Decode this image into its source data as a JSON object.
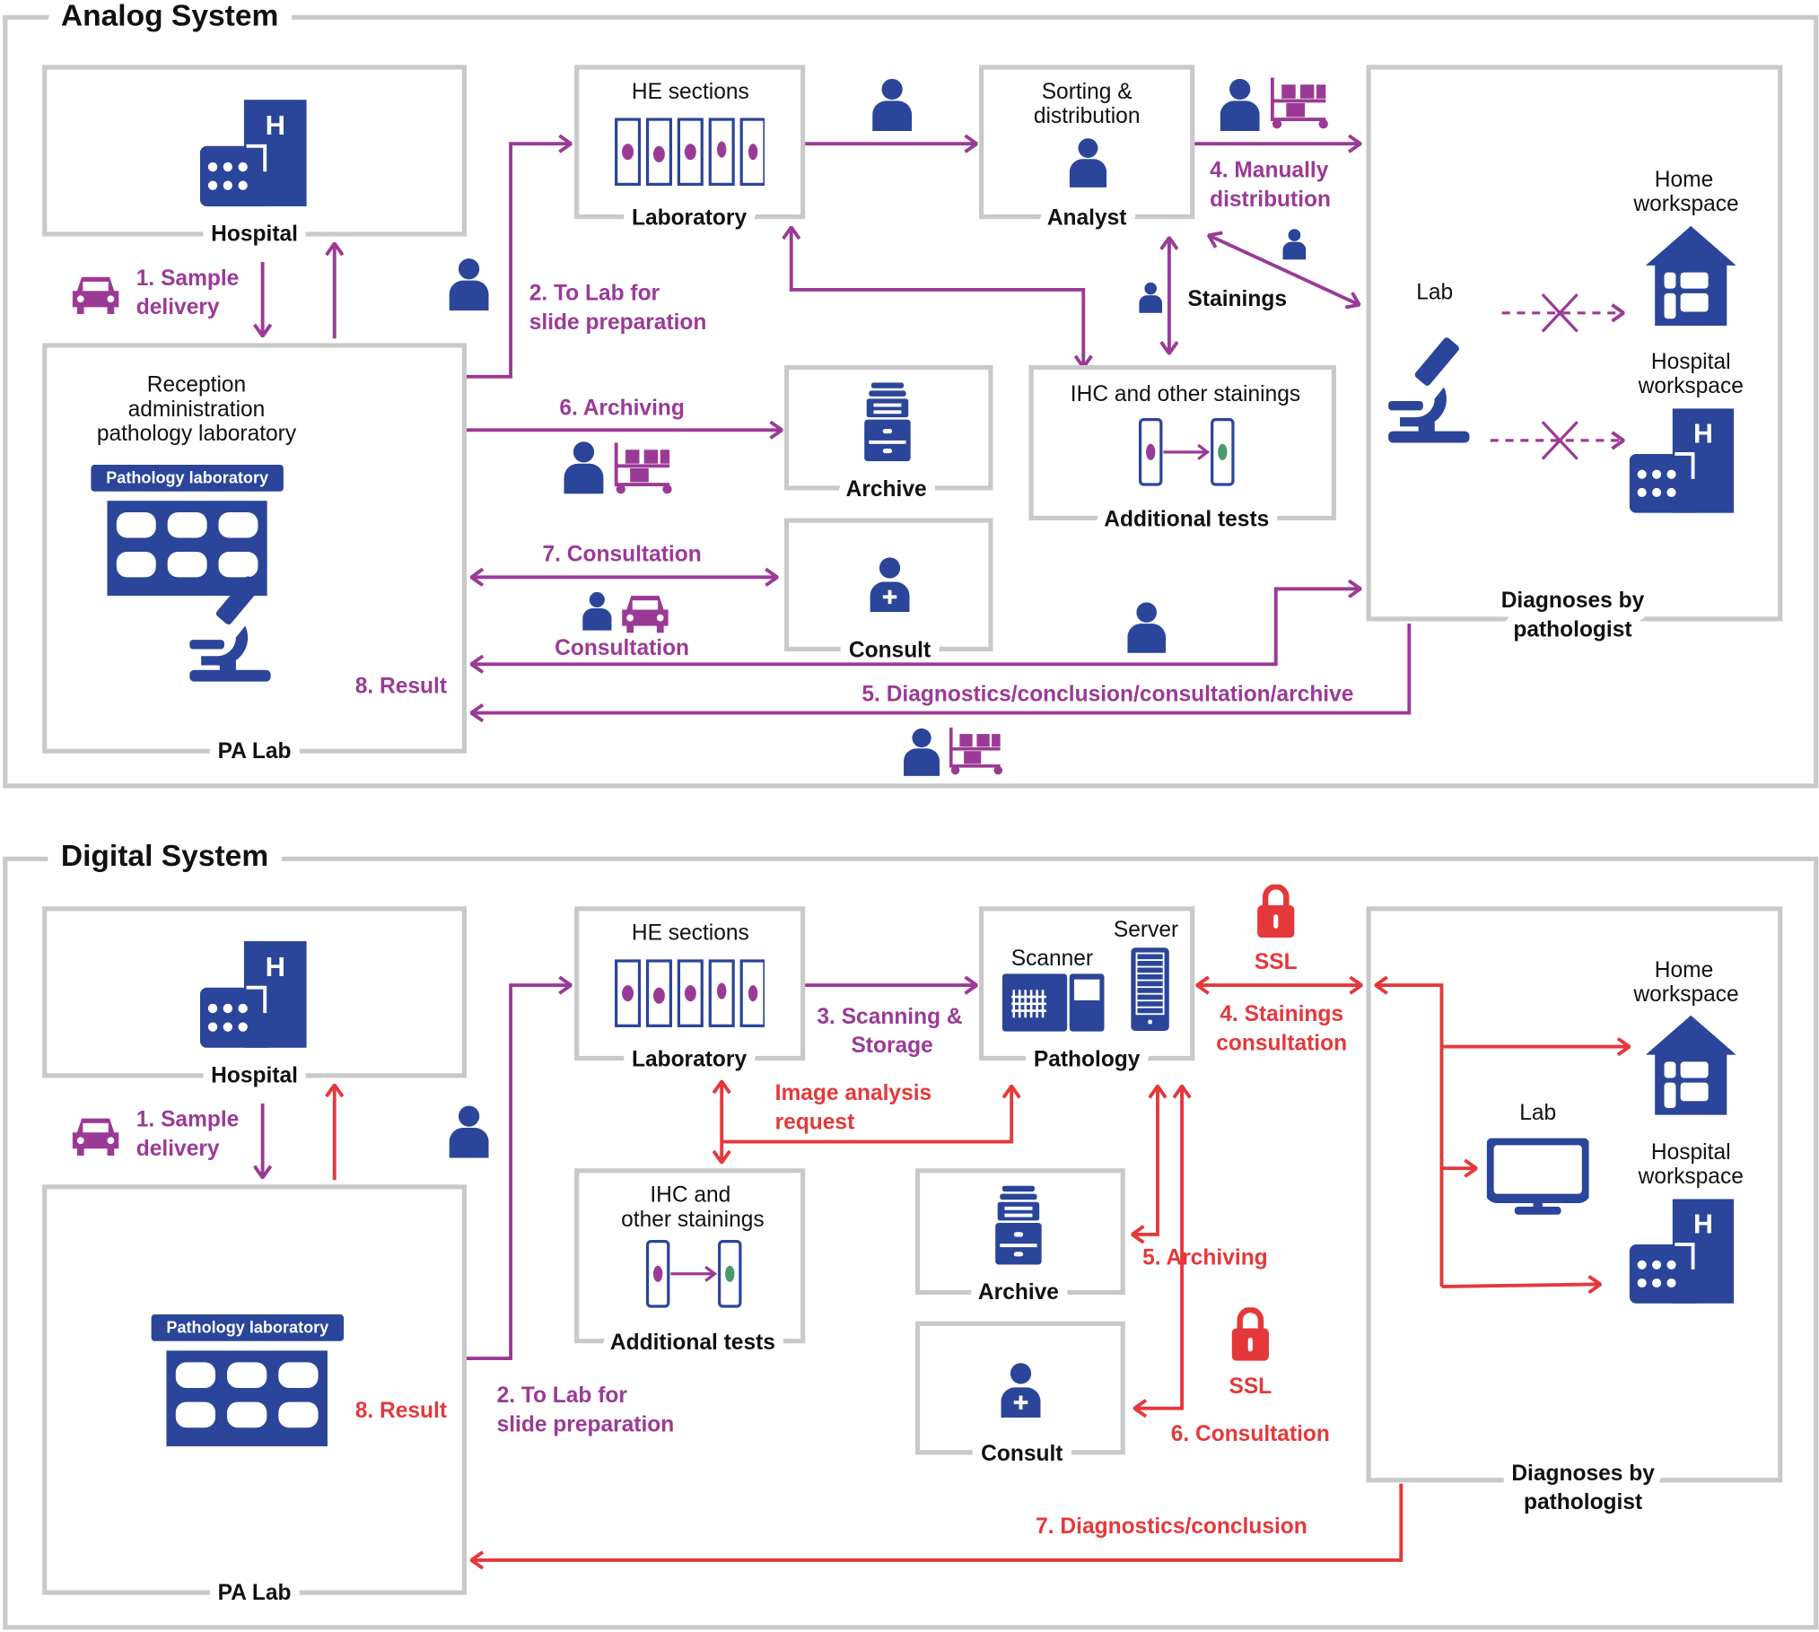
{
  "colors": {
    "navy": "#2a4599",
    "purple": "#9b3a96",
    "red": "#e5383b",
    "gray": "#c9c9c9"
  },
  "analog": {
    "title": "Analog System",
    "hospital": {
      "label": "Hospital"
    },
    "sample_delivery": [
      "1. Sample",
      "delivery"
    ],
    "pa_lab": {
      "label": "PA Lab",
      "desc": [
        "Reception",
        "administration",
        "pathology laboratory"
      ],
      "badge": "Pathology laboratory"
    },
    "to_lab": [
      "2. To Lab for",
      "slide preparation"
    ],
    "laboratory": {
      "header": "HE sections",
      "label": "Laboratory"
    },
    "sorting": {
      "header": [
        "Sorting &",
        "distribution"
      ],
      "label": "Analyst"
    },
    "manual_distribution": [
      "4. Manually",
      "distribution"
    ],
    "stainings": "Stainings",
    "ihc": {
      "header": "IHC and other stainings",
      "label": "Additional tests"
    },
    "archiving": "6. Archiving",
    "archive": {
      "label": "Archive"
    },
    "consultation_flow": "7. Consultation",
    "consultation_sub": "Consultation",
    "consult": {
      "label": "Consult"
    },
    "result": "8. Result",
    "diagnostics": "5. Diagnostics/conclusion/consultation/archive",
    "diagnoses": {
      "lab": "Lab",
      "home": [
        "Home",
        "workspace"
      ],
      "hospital": [
        "Hospital",
        "workspace"
      ],
      "label": [
        "Diagnoses by",
        "pathologist"
      ]
    }
  },
  "digital": {
    "title": "Digital System",
    "hospital": {
      "label": "Hospital"
    },
    "sample_delivery": [
      "1. Sample",
      "delivery"
    ],
    "pa_lab": {
      "label": "PA Lab",
      "badge": "Pathology laboratory"
    },
    "result": "8. Result",
    "to_lab": [
      "2. To Lab for",
      "slide preparation"
    ],
    "laboratory": {
      "header": "HE sections",
      "label": "Laboratory"
    },
    "scanning": [
      "3. Scanning &",
      "Storage"
    ],
    "pathology": {
      "server": "Server",
      "scanner": "Scanner",
      "label": "Pathology"
    },
    "ssl_1": "SSL",
    "stainings_consultation": [
      "4. Stainings",
      "consultation"
    ],
    "image_analysis": [
      "Image analysis",
      "request"
    ],
    "ihc": {
      "header": [
        "IHC and",
        "other stainings"
      ],
      "label": "Additional tests"
    },
    "archive": {
      "label": "Archive"
    },
    "archiving": "5. Archiving",
    "ssl_2": "SSL",
    "consultation": "6. Consultation",
    "consult": {
      "label": "Consult"
    },
    "diagnostics": "7. Diagnostics/conclusion",
    "diagnoses": {
      "lab": "Lab",
      "home": [
        "Home",
        "workspace"
      ],
      "hospital": [
        "Hospital",
        "workspace"
      ],
      "label": [
        "Diagnoses by",
        "pathologist"
      ]
    }
  },
  "icons": [
    "hospital-icon",
    "car-icon",
    "person-icon",
    "cart-icon",
    "microscope-icon",
    "archive-icon",
    "consult-icon",
    "lock-icon",
    "house-icon",
    "monitor-icon",
    "scanner-icon",
    "server-icon",
    "slides-icon",
    "grid-icon"
  ]
}
